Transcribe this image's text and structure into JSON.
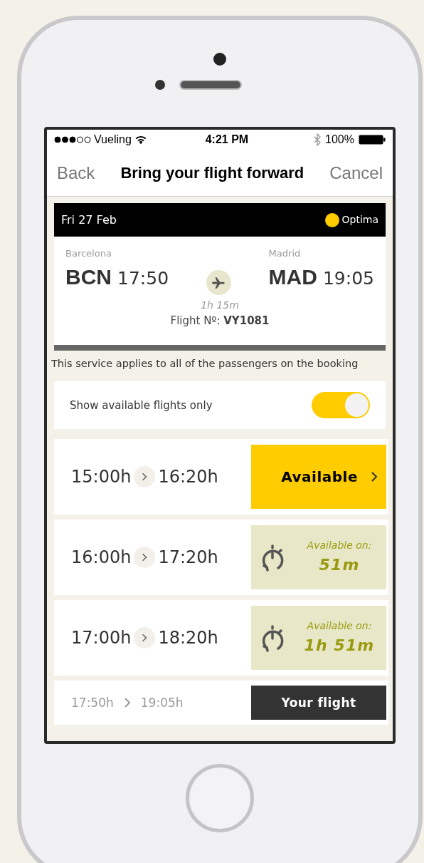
{
  "status_bar": {
    "carrier": "Vueling",
    "time": "4:21 PM",
    "battery": "100%"
  },
  "nav": {
    "back": "Back",
    "title": "Bring your flight forward",
    "cancel": "Cancel"
  },
  "flight": {
    "date": "Fri 27 Feb",
    "fare": "Optima",
    "origin": {
      "city": "Barcelona",
      "code": "BCN",
      "time": "17:50"
    },
    "destination": {
      "city": "Madrid",
      "code": "MAD",
      "time": "19:05"
    },
    "duration": "1h 15m",
    "flight_number": "Flight Nº: **VY1081**"
  },
  "notice": "This service applies to all of the passengers on the booking",
  "filter": {
    "label": "Show available flights only",
    "on": true
  },
  "options": [
    {
      "kind": "available",
      "depart": "15:00h",
      "arrive": "16:20h",
      "status": "Available"
    },
    {
      "kind": "countdown",
      "depart": "16:00h",
      "arrive": "17:20h",
      "status": "Available on:",
      "wait": "51m"
    },
    {
      "kind": "countdown",
      "depart": "17:00h",
      "arrive": "18:20h",
      "status": "Available on:",
      "wait": "1h 51m"
    },
    {
      "kind": "current",
      "depart": "17:50h",
      "arrive": "19:05h",
      "status": "Your flight"
    }
  ]
}
